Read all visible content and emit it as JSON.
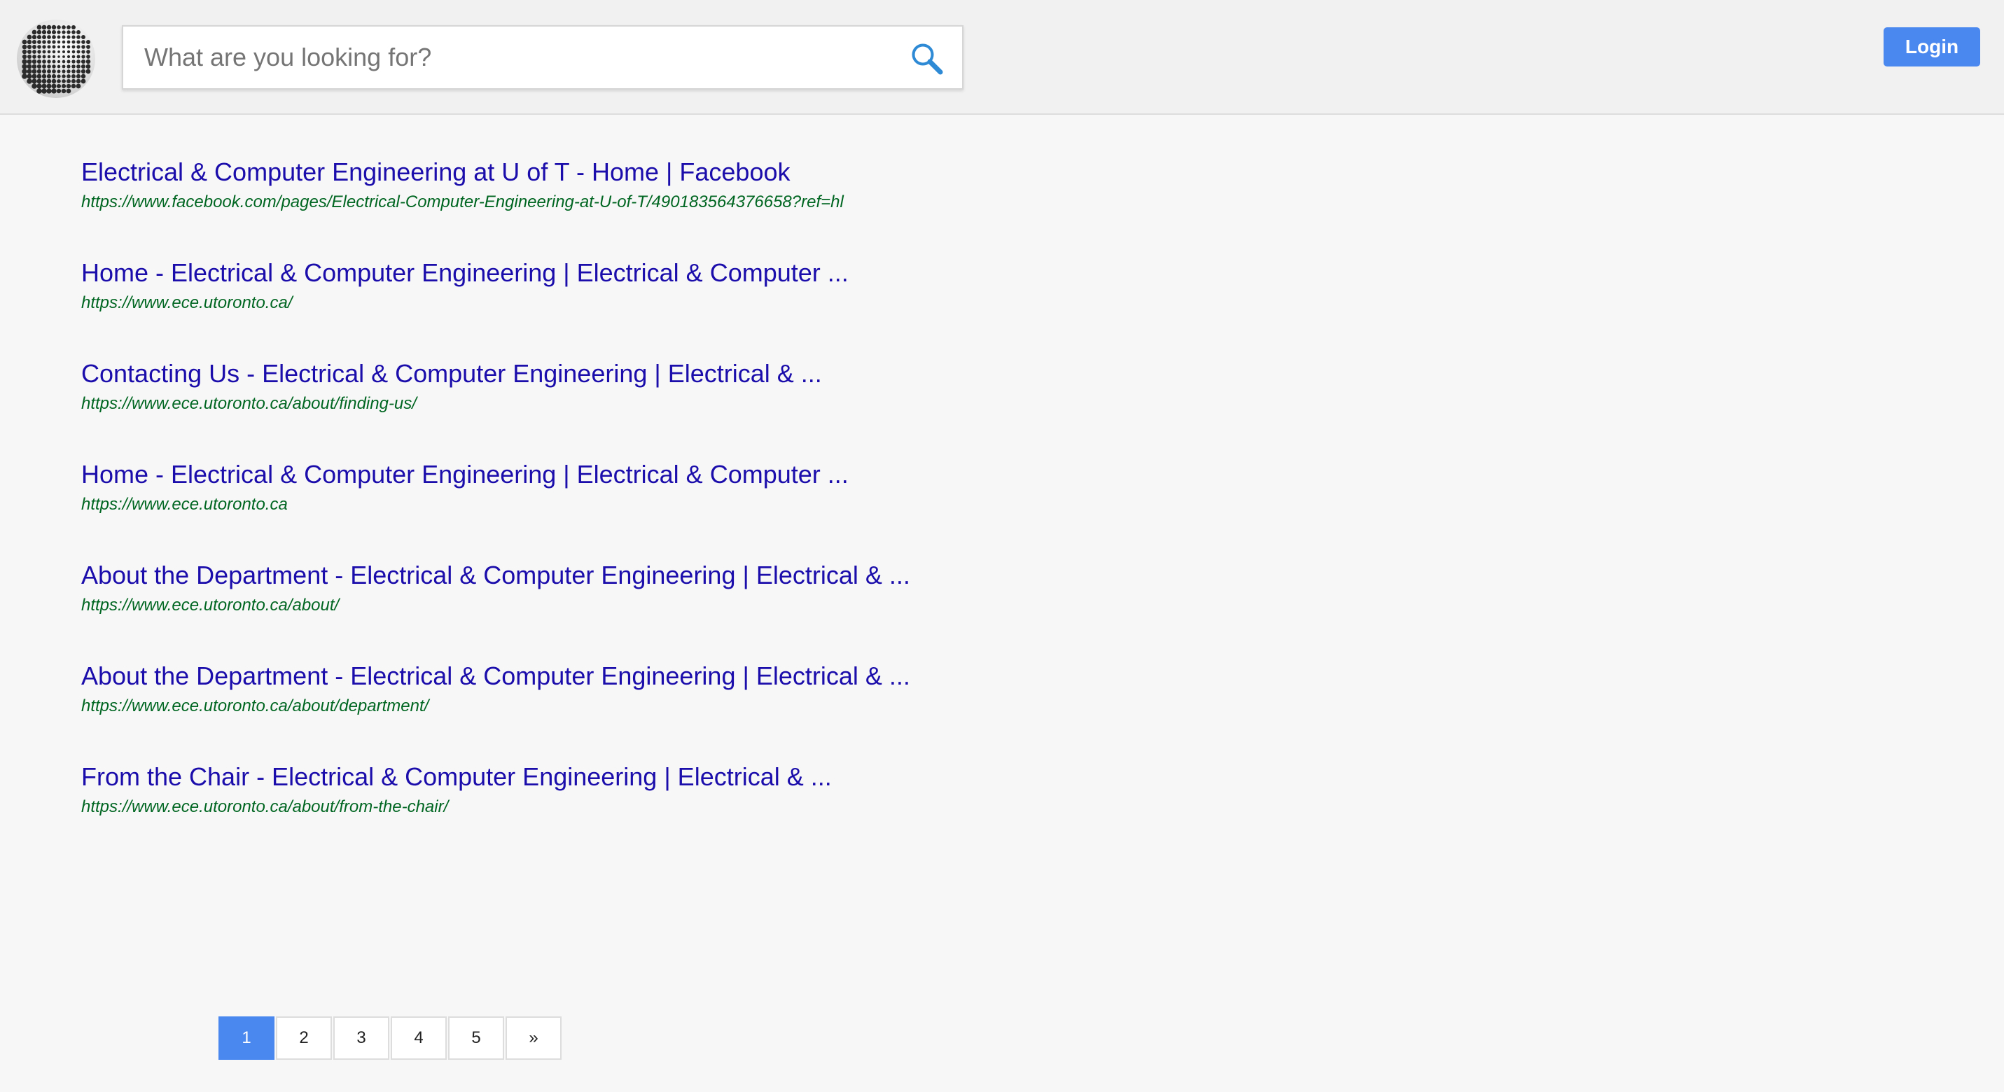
{
  "search": {
    "placeholder": "What are you looking for?"
  },
  "header": {
    "login_label": "Login",
    "logo_icon": "dotted-globe-icon",
    "search_icon": "search-icon"
  },
  "colors": {
    "accent": "#4a87ee",
    "title_link": "#1a0dab",
    "url_text": "#006621"
  },
  "results": [
    {
      "title": "Electrical & Computer Engineering at U of T - Home | Facebook",
      "url": "https://www.facebook.com/pages/Electrical-Computer-Engineering-at-U-of-T/490183564376658?ref=hl"
    },
    {
      "title": "Home - Electrical & Computer Engineering | Electrical & Computer ...",
      "url": "https://www.ece.utoronto.ca/"
    },
    {
      "title": "Contacting Us - Electrical & Computer Engineering | Electrical & ...",
      "url": "https://www.ece.utoronto.ca/about/finding-us/"
    },
    {
      "title": "Home - Electrical & Computer Engineering | Electrical & Computer ...",
      "url": "https://www.ece.utoronto.ca"
    },
    {
      "title": "About the Department - Electrical & Computer Engineering | Electrical & ...",
      "url": "https://www.ece.utoronto.ca/about/"
    },
    {
      "title": "About the Department - Electrical & Computer Engineering | Electrical & ...",
      "url": "https://www.ece.utoronto.ca/about/department/"
    },
    {
      "title": "From the Chair - Electrical & Computer Engineering | Electrical & ...",
      "url": "https://www.ece.utoronto.ca/about/from-the-chair/"
    }
  ],
  "pagination": {
    "pages": [
      "1",
      "2",
      "3",
      "4",
      "5"
    ],
    "current": "1",
    "next_label": "»"
  }
}
